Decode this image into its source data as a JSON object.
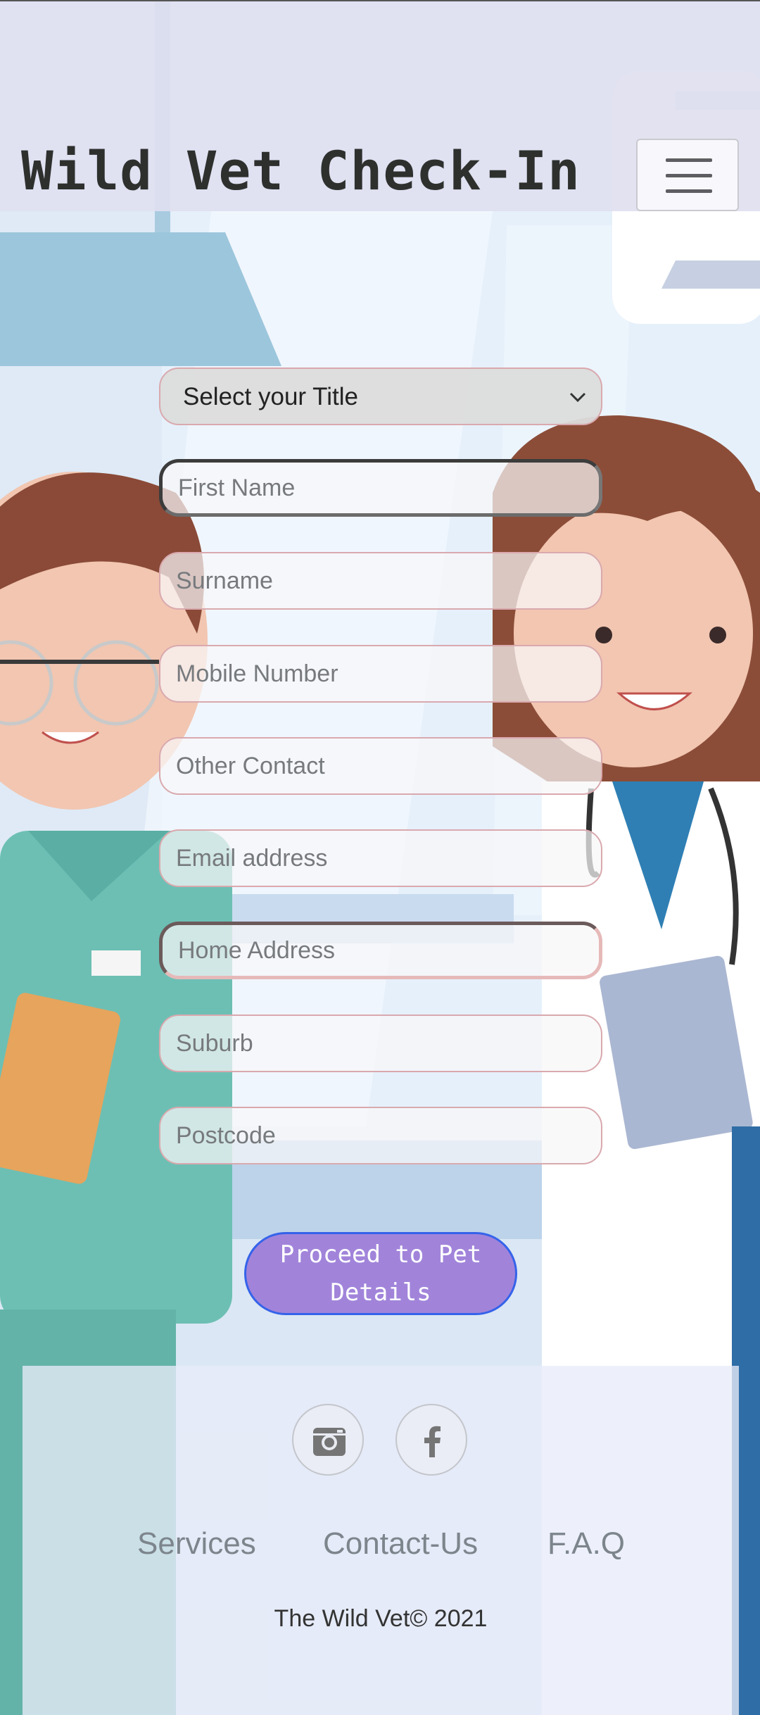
{
  "header": {
    "title": "Wild Vet Check-In",
    "menu_icon": "hamburger-menu-icon"
  },
  "form": {
    "title_select": {
      "selected": "Select your Title",
      "icon": "chevron-down-icon"
    },
    "fields": [
      {
        "placeholder": "First Name",
        "value": ""
      },
      {
        "placeholder": "Surname",
        "value": ""
      },
      {
        "placeholder": "Mobile Number",
        "value": ""
      },
      {
        "placeholder": "Other Contact",
        "value": ""
      },
      {
        "placeholder": "Email address",
        "value": ""
      },
      {
        "placeholder": "Home Address",
        "value": ""
      },
      {
        "placeholder": "Suburb",
        "value": ""
      },
      {
        "placeholder": "Postcode",
        "value": ""
      }
    ],
    "submit_label": "Proceed to Pet Details"
  },
  "footer": {
    "social": [
      {
        "icon": "instagram-icon"
      },
      {
        "icon": "facebook-icon"
      }
    ],
    "links": [
      "Services",
      "Contact-Us",
      "F.A.Q"
    ],
    "copyright": "The Wild Vet© 2021"
  },
  "colors": {
    "button_fill": "#a184da",
    "button_border": "#3563ea",
    "field_border": "#d9a9ae",
    "header_bg": "#e0e0f0"
  }
}
